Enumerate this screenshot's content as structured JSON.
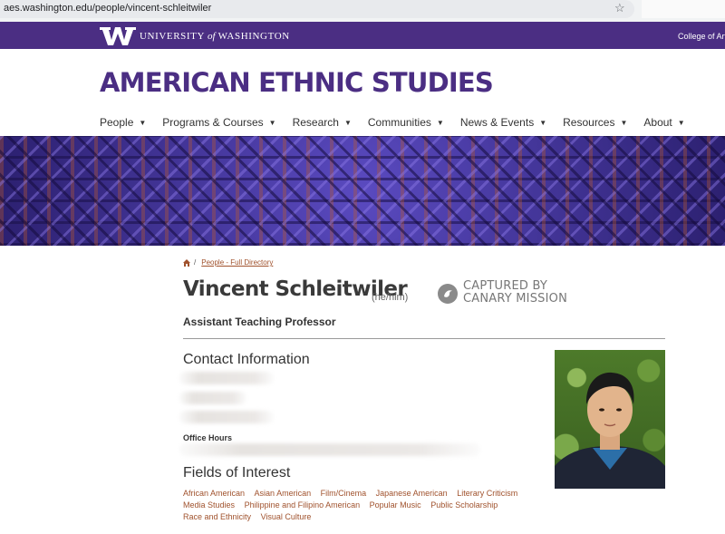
{
  "browser": {
    "url": "aes.washington.edu/people/vincent-schleitwiler",
    "star_icon": "star-icon"
  },
  "uw_header": {
    "wordmark_pre": "UNIVERSITY",
    "wordmark_of": "of",
    "wordmark_post": "WASHINGTON",
    "college_link": "College of Arts",
    "brand_color": "#4b2e83"
  },
  "department": {
    "title": "AMERICAN ETHNIC STUDIES"
  },
  "nav": {
    "items": [
      {
        "label": "People"
      },
      {
        "label": "Programs & Courses"
      },
      {
        "label": "Research"
      },
      {
        "label": "Communities"
      },
      {
        "label": "News & Events"
      },
      {
        "label": "Resources"
      },
      {
        "label": "About"
      }
    ]
  },
  "breadcrumb": {
    "separator": "/",
    "link": "People - Full Directory"
  },
  "person": {
    "name": "Vincent Schleitwiler",
    "pronouns": "(he/him)",
    "title": "Assistant Teaching Professor",
    "photo_alt": "Portrait photo"
  },
  "badge": {
    "line1": "CAPTURED BY",
    "line2": "CANARY MISSION"
  },
  "contact": {
    "heading": "Contact Information",
    "office_hours_label": "Office Hours"
  },
  "interests": {
    "heading": "Fields of Interest",
    "items": [
      "African American",
      "Asian American",
      "Film/Cinema",
      "Japanese American",
      "Literary Criticism",
      "Media Studies",
      "Philippine and Filipino American",
      "Popular Music",
      "Public Scholarship",
      "Race and Ethnicity",
      "Visual Culture"
    ]
  },
  "colors": {
    "link": "#a0522d",
    "heading_purple": "#4b2e83"
  }
}
